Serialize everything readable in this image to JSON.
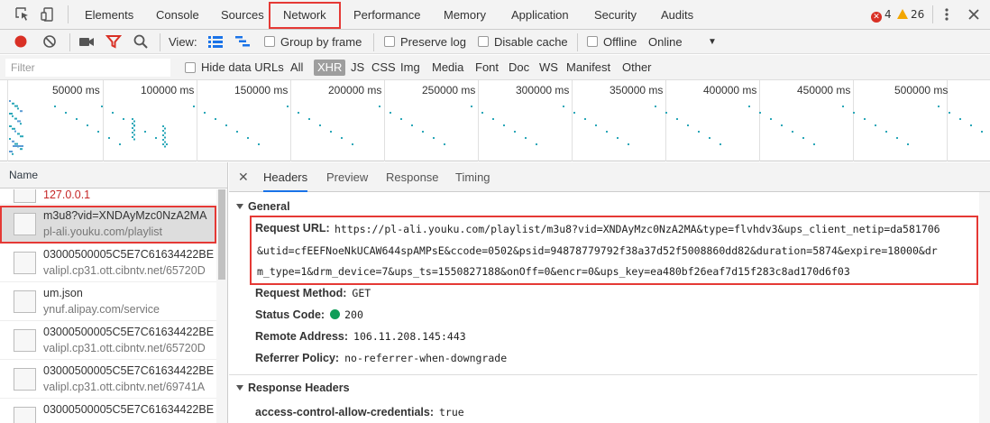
{
  "tabs": [
    "Elements",
    "Console",
    "Sources",
    "Network",
    "Performance",
    "Memory",
    "Application",
    "Security",
    "Audits"
  ],
  "status": {
    "errors": "4",
    "warnings": "26"
  },
  "toolbar": {
    "view_label": "View:",
    "group_by_frame": "Group by frame",
    "preserve_log": "Preserve log",
    "disable_cache": "Disable cache",
    "offline": "Offline",
    "throttle_value": "Online"
  },
  "filter": {
    "placeholder": "Filter",
    "hide_data_urls": "Hide data URLs",
    "types": [
      "All",
      "XHR",
      "JS",
      "CSS",
      "Img",
      "Media",
      "Font",
      "Doc",
      "WS",
      "Manifest",
      "Other"
    ],
    "selected": "XHR"
  },
  "overview": {
    "ticks": [
      "50000 ms",
      "100000 ms",
      "150000 ms",
      "200000 ms",
      "250000 ms",
      "300000 ms",
      "350000 ms",
      "400000 ms",
      "450000 ms",
      "500000 ms"
    ]
  },
  "list": {
    "header": "Name",
    "rows": [
      {
        "name": "127.0.0.1",
        "domain": ""
      },
      {
        "name": "m3u8?vid=XNDAyMzc0NzA2MA",
        "domain": "pl-ali.youku.com/playlist"
      },
      {
        "name": "03000500005C5E7C61634422BE",
        "domain": "valipl.cp31.ott.cibntv.net/65720D"
      },
      {
        "name": "um.json",
        "domain": "ynuf.alipay.com/service"
      },
      {
        "name": "03000500005C5E7C61634422BE",
        "domain": "valipl.cp31.ott.cibntv.net/65720D"
      },
      {
        "name": "03000500005C5E7C61634422BE",
        "domain": "valipl.cp31.ott.cibntv.net/69741A"
      },
      {
        "name": "03000500005C5E7C61634422BE",
        "domain": ""
      }
    ]
  },
  "detail": {
    "close": "✕",
    "tabs": [
      "Headers",
      "Preview",
      "Response",
      "Timing"
    ],
    "general_label": "General",
    "request_url_label": "Request URL:",
    "request_url_lines": [
      "https://pl-ali.youku.com/playlist/m3u8?vid=XNDAyMzc0NzA2MA&type=flvhdv3&ups_client_netip=da581706",
      "&utid=cfEEFNoeNkUCAW644spAMPsE&ccode=0502&psid=94878779792f38a37d52f5008860dd82&duration=5874&expire=18000&dr",
      "m_type=1&drm_device=7&ups_ts=1550827188&onOff=0&encr=0&ups_key=ea480bf26eaf7d15f283c8ad170d6f03"
    ],
    "request_method_label": "Request Method:",
    "request_method": "GET",
    "status_code_label": "Status Code:",
    "status_code": "200",
    "remote_address_label": "Remote Address:",
    "remote_address": "106.11.208.145:443",
    "referrer_policy_label": "Referrer Policy:",
    "referrer_policy": "no-referrer-when-downgrade",
    "response_headers_label": "Response Headers",
    "acac_label": "access-control-allow-credentials:",
    "acac_value": "true"
  }
}
